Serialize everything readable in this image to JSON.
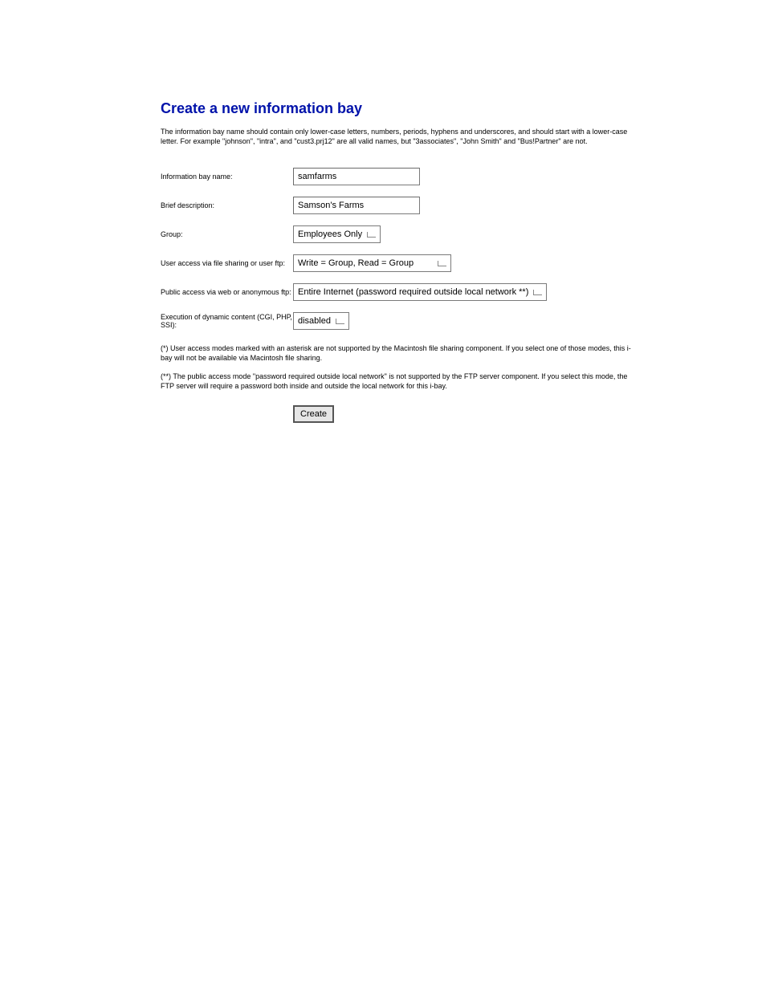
{
  "heading": "Create a new information bay",
  "intro": "The information bay name should contain only lower-case letters, numbers, periods, hyphens and underscores, and should start with a lower-case letter. For example \"johnson\", \"intra\", and \"cust3.prj12\" are all valid names, but \"3associates\", \"John Smith\" and \"Bus!Partner\" are not.",
  "labels": {
    "name": "Information bay name:",
    "desc": "Brief description:",
    "group": "Group:",
    "user_access": "User access via file sharing or user ftp:",
    "public_access": "Public access via web or anonymous ftp:",
    "dynamic": "Execution of dynamic content (CGI, PHP, SSI):"
  },
  "values": {
    "name": "samfarms",
    "desc": "Samson's Farms",
    "group": "Employees Only",
    "user_access": "Write = Group, Read = Group",
    "public_access": "Entire Internet (password required outside local network **)",
    "dynamic": "disabled"
  },
  "note1": "(*) User access modes marked with an asterisk are not supported by the Macintosh file sharing component. If you select one of those modes, this i-bay will not be available via Macintosh file sharing.",
  "note2": "(**) The public access mode \"password required outside local network\" is not supported by the FTP server component. If you select this mode, the FTP server will require a password both inside and outside the local network for this i-bay.",
  "button": "Create"
}
